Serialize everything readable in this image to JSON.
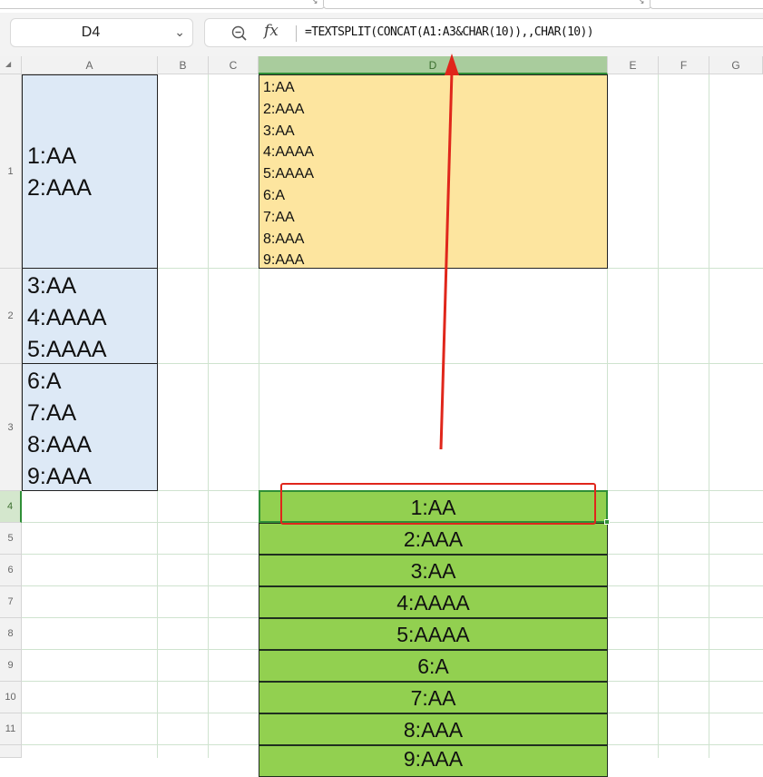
{
  "formula_bar": {
    "cell_reference": "D4",
    "formula": "=TEXTSPLIT(CONCAT(A1:A3&CHAR(10)),,CHAR(10))",
    "icons": [
      "chevron-down-icon",
      "zoom-icon",
      "fx-icon"
    ]
  },
  "columns": [
    "A",
    "B",
    "C",
    "D",
    "E",
    "F",
    "G"
  ],
  "rows": [
    "1",
    "2",
    "3",
    "4",
    "5",
    "6",
    "7",
    "8",
    "9",
    "10",
    "11"
  ],
  "selected": {
    "column": "D",
    "row": "4"
  },
  "cells": {
    "a1": [
      "1:AA",
      "2:AAA"
    ],
    "a2": [
      "3:AA",
      "4:AAAA",
      "5:AAAA"
    ],
    "a3": [
      "6:A",
      "7:AA",
      "8:AAA",
      "9:AAA"
    ],
    "d1": [
      "1:AA",
      "2:AAA",
      "3:AA",
      "4:AAAA",
      "5:AAAA",
      "6:A",
      "7:AA",
      "8:AAA",
      "9:AAA"
    ],
    "spill": [
      "1:AA",
      "2:AAA",
      "3:AA",
      "4:AAAA",
      "5:AAAA",
      "6:A",
      "7:AA",
      "8:AAA",
      "9:AAA"
    ]
  },
  "colors": {
    "column_a_fill": "#dde9f6",
    "d1_fill": "#fde59f",
    "spill_fill": "#92d050",
    "annotation": "#e0261b",
    "selection": "#2f8f36"
  }
}
